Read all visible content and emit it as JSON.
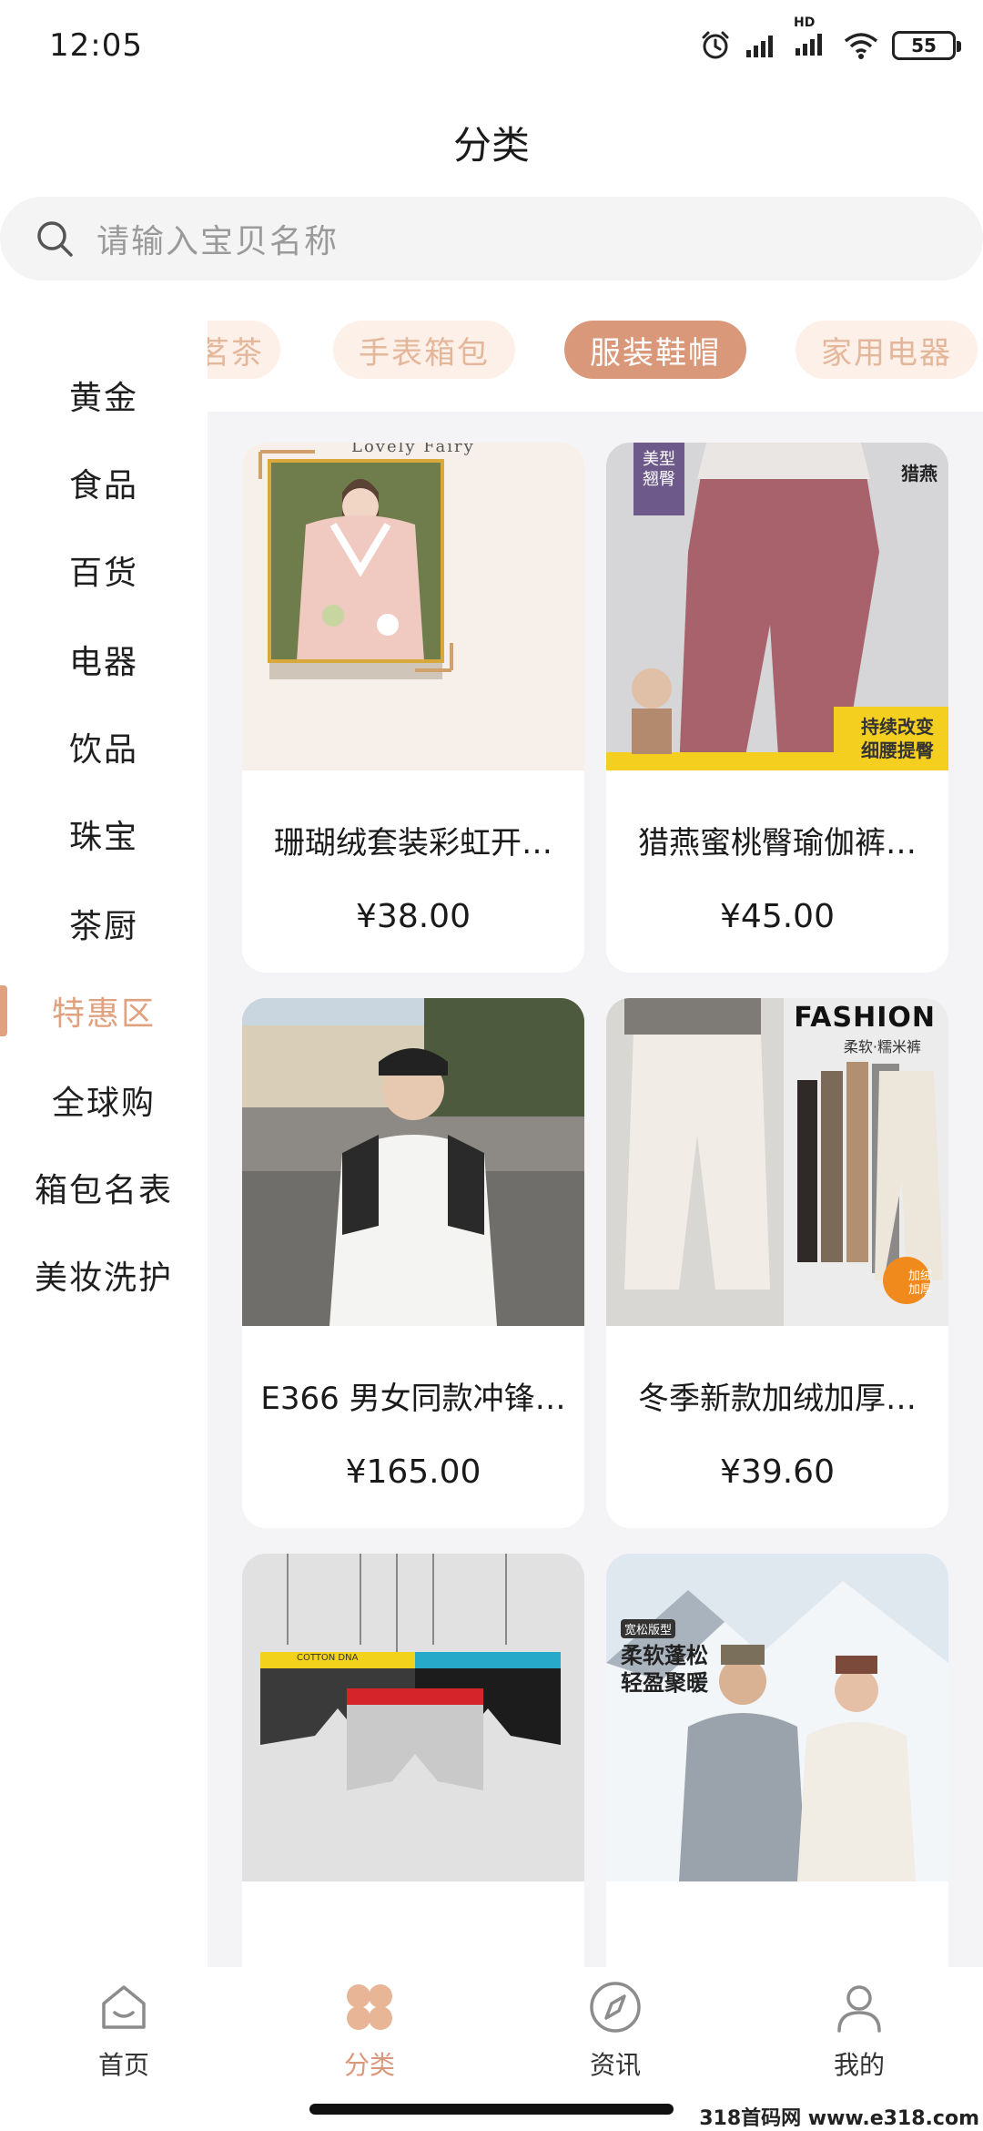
{
  "status_bar": {
    "time": "12:05",
    "battery": "55",
    "network": "HD"
  },
  "header": {
    "title": "分类"
  },
  "search": {
    "placeholder": "请输入宝贝名称"
  },
  "sidebar": {
    "items": [
      {
        "label": "黄金"
      },
      {
        "label": "食品"
      },
      {
        "label": "百货"
      },
      {
        "label": "电器"
      },
      {
        "label": "饮品"
      },
      {
        "label": "珠宝"
      },
      {
        "label": "茶厨"
      },
      {
        "label": "特惠区",
        "active": true
      },
      {
        "label": "全球购"
      },
      {
        "label": "箱包名表"
      },
      {
        "label": "美妆洗护"
      }
    ]
  },
  "subcategories": [
    {
      "label": "茗茶"
    },
    {
      "label": "手表箱包"
    },
    {
      "label": "服装鞋帽",
      "active": true
    },
    {
      "label": "家用电器"
    }
  ],
  "products": [
    {
      "title": "珊瑚绒套装彩虹开…",
      "price": "¥38.00",
      "image_text": "Lovely Fairy"
    },
    {
      "title": "猎燕蜜桃臀瑜伽裤…",
      "price": "¥45.00",
      "image_text": [
        "美型翘臀",
        "猎燕",
        "持续改变",
        "细腰提臀"
      ]
    },
    {
      "title": "E366 男女同款冲锋…",
      "price": "¥165.00"
    },
    {
      "title": "冬季新款加绒加厚…",
      "price": "¥39.60",
      "image_text": [
        "FASHION",
        "柔软·糯米裤",
        "加绒加厚"
      ]
    },
    {
      "title": "",
      "price": "",
      "image_text": "COTTON DNA"
    },
    {
      "title": "",
      "price": "",
      "image_text": [
        "宽松版型",
        "柔软蓬松",
        "轻盈聚暖"
      ]
    }
  ],
  "bottom_nav": [
    {
      "label": "首页",
      "icon": "home-icon"
    },
    {
      "label": "分类",
      "icon": "category-icon",
      "active": true
    },
    {
      "label": "资讯",
      "icon": "compass-icon"
    },
    {
      "label": "我的",
      "icon": "profile-icon"
    }
  ],
  "watermark": "318首码网 www.e318.com",
  "colors": {
    "accent": "#d9987a",
    "chip_bg": "#fdf0e8",
    "content_bg": "#f4f4f6"
  }
}
